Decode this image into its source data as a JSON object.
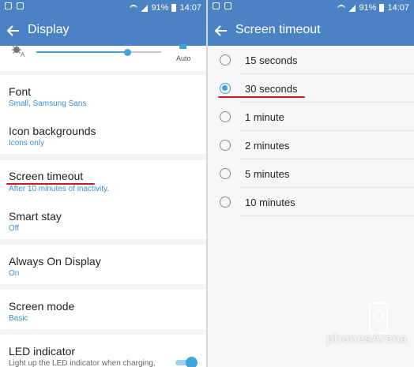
{
  "statusbar": {
    "battery": "91%",
    "time": "14:07"
  },
  "left": {
    "title": "Display",
    "brightness": {
      "auto_label": "Auto",
      "level": 0.73
    },
    "items": [
      {
        "title": "Font",
        "subtitle": "Small, Samsung Sans"
      },
      {
        "title": "Icon backgrounds",
        "subtitle": "Icons only"
      },
      {
        "title": "Screen timeout",
        "subtitle": "After 10 minutes of inactivity."
      },
      {
        "title": "Smart stay",
        "subtitle": "Off"
      },
      {
        "title": "Always On Display",
        "subtitle": "On"
      },
      {
        "title": "Screen mode",
        "subtitle": "Basic"
      },
      {
        "title": "LED indicator",
        "subtitle": "Light up the LED indicator when charging,"
      }
    ],
    "led_toggle_on": true
  },
  "right": {
    "title": "Screen timeout",
    "options": [
      "15 seconds",
      "30 seconds",
      "1 minute",
      "2 minutes",
      "5 minutes",
      "10 minutes"
    ],
    "selected_index": 1
  },
  "watermark": "phonesArena",
  "colors": {
    "appbar": "#4b82c4",
    "accent": "#3ea4d9",
    "underline": "#d11818"
  }
}
